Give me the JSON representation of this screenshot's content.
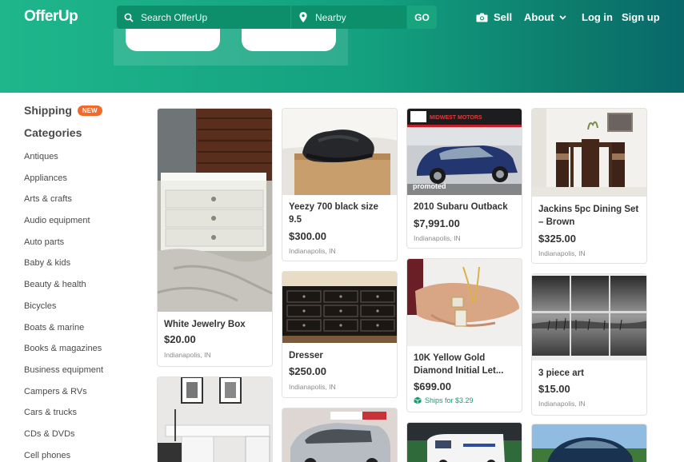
{
  "header": {
    "logo": "OfferUp",
    "search_placeholder": "Search OfferUp",
    "location": "Nearby",
    "go": "GO",
    "nav": {
      "sell": "Sell",
      "about": "About",
      "login": "Log in",
      "signup": "Sign up"
    }
  },
  "sidebar": {
    "shipping": "Shipping",
    "shipping_badge": "NEW",
    "categories_title": "Categories",
    "categories": [
      "Antiques",
      "Appliances",
      "Arts & crafts",
      "Audio equipment",
      "Auto parts",
      "Baby & kids",
      "Beauty & health",
      "Bicycles",
      "Boats & marine",
      "Books & magazines",
      "Business equipment",
      "Campers & RVs",
      "Cars & trucks",
      "CDs & DVDs",
      "Cell phones"
    ]
  },
  "listings": {
    "jewelry_box": {
      "title": "White Jewelry Box",
      "price": "$20.00",
      "location": "Indianapolis, IN"
    },
    "yeezy": {
      "title": "Yeezy 700 black size 9.5",
      "price": "$300.00",
      "location": "Indianapolis, IN"
    },
    "subaru": {
      "title": "2010 Subaru Outback",
      "price": "$7,991.00",
      "location": "Indianapolis, IN",
      "badge": "promoted",
      "dealer": "MIDWEST MOTORS"
    },
    "dining_set": {
      "title": "Jackins 5pc Dining Set – Brown",
      "price": "$325.00",
      "location": "Indianapolis, IN"
    },
    "dresser": {
      "title": "Dresser",
      "price": "$250.00",
      "location": "Indianapolis, IN"
    },
    "gold_chain": {
      "title": "10K Yellow Gold Diamond Initial Let...",
      "price": "$699.00",
      "shipping": "Ships for $3.29"
    },
    "art": {
      "title": "3 piece art",
      "price": "$15.00",
      "location": "Indianapolis, IN"
    }
  },
  "colors": {
    "brand": "#1fb68c",
    "badge_new": "#f06a2c",
    "ship_green": "#1a9c6f"
  }
}
